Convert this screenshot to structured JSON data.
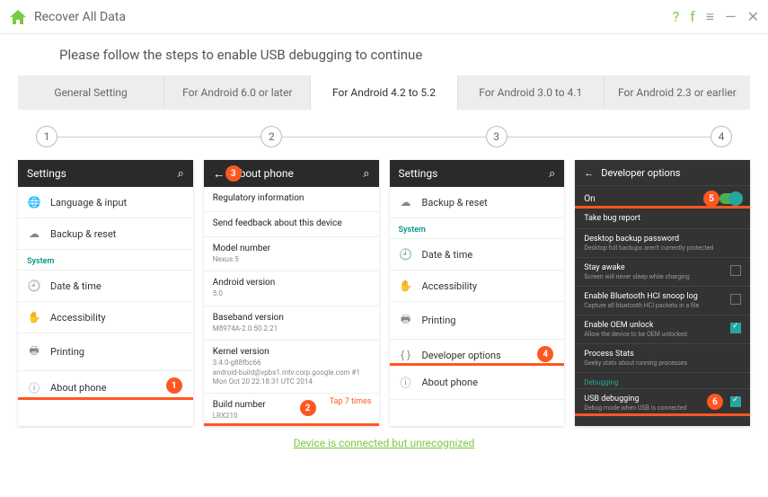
{
  "titlebar": {
    "title": "Recover All Data"
  },
  "instruction": "Please follow the steps to enable USB debugging to continue",
  "tabs": [
    "General Setting",
    "For Android 6.0 or later",
    "For Android 4.2 to 5.2",
    "For Android 3.0 to 4.1",
    "For Android 2.3 or earlier"
  ],
  "active_tab": 2,
  "steps": [
    1,
    2,
    3,
    4
  ],
  "panel1": {
    "title": "Settings",
    "rows": [
      {
        "icon": "🌐",
        "label": "Language & input"
      },
      {
        "icon": "☁",
        "label": "Backup & reset"
      }
    ],
    "section": "System",
    "rows2": [
      {
        "icon": "🕘",
        "label": "Date & time"
      },
      {
        "icon": "✋",
        "label": "Accessibility"
      },
      {
        "icon": "🖶",
        "label": "Printing"
      },
      {
        "icon": "ⓘ",
        "label": "About phone",
        "badge": 1,
        "ul": true
      }
    ]
  },
  "panel2": {
    "title": "About phone",
    "badge": 3,
    "info": [
      {
        "k": "Regulatory information"
      },
      {
        "k": "Send feedback about this device"
      },
      {
        "k": "Model number",
        "v": "Nexus 5"
      },
      {
        "k": "Android version",
        "v": "5.0"
      },
      {
        "k": "Baseband version",
        "v": "M8974A-2.0.50.2.21"
      },
      {
        "k": "Kernel version",
        "v": "3.4.0-g88fbc66\nandroid-build@vpbs1.mtv.corp.google.com #1\nMon Oct 20 22:18:31 UTC 2014"
      },
      {
        "k": "Build number",
        "v": "LRX210",
        "badge": 2,
        "ul": true,
        "tap": "Tap 7 times"
      }
    ]
  },
  "panel3": {
    "title": "Settings",
    "rows": [
      {
        "icon": "☁",
        "label": "Backup & reset"
      }
    ],
    "section": "System",
    "rows2": [
      {
        "icon": "🕘",
        "label": "Date & time"
      },
      {
        "icon": "✋",
        "label": "Accessibility"
      },
      {
        "icon": "🖶",
        "label": "Printing"
      },
      {
        "icon": "{ }",
        "label": "Developer options",
        "badge": 4,
        "ul": true
      },
      {
        "icon": "ⓘ",
        "label": "About phone"
      }
    ]
  },
  "panel4": {
    "title": "Developer options",
    "on": "On",
    "badge_on": 5,
    "rows": [
      {
        "k": "Take bug report"
      },
      {
        "k": "Desktop backup password",
        "v": "Desktop full backups aren't currently protected"
      },
      {
        "k": "Stay awake",
        "v": "Screen will never sleep while charging",
        "chk": false
      },
      {
        "k": "Enable Bluetooth HCI snoop log",
        "v": "Capture all bluetooth HCI packets in a file",
        "chk": false
      },
      {
        "k": "Enable OEM unlock",
        "v": "Allow the device to be OEM unlocked",
        "chk": true
      },
      {
        "k": "Process Stats",
        "v": "Geeky stats about running processes"
      }
    ],
    "section": "Debugging",
    "rows2": [
      {
        "k": "USB debugging",
        "v": "Debug mode when USB is connected",
        "chk": true,
        "badge": 6,
        "ul": true
      }
    ]
  },
  "footer": {
    "link": "Device is connected but unrecognized"
  }
}
